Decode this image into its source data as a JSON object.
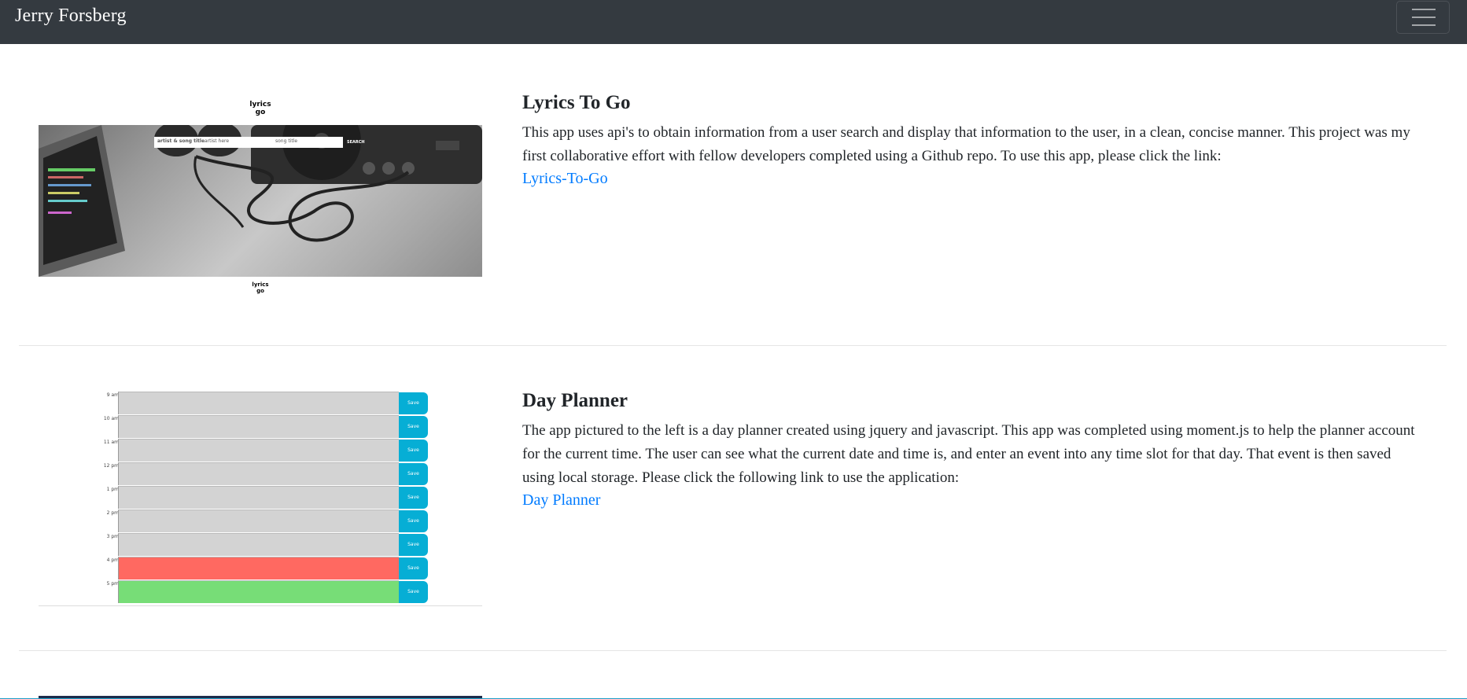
{
  "navbar": {
    "brand": "Jerry Forsberg",
    "menu_icon": "hamburger-menu-icon",
    "background": "#343a40"
  },
  "projects": [
    {
      "title": "Lyrics To Go",
      "description": "This app uses api's to obtain information from a user search and display that information to the user, in a clean, concise manner. This project was my first collaborative effort with fellow developers completed using a Github repo. To use this app, please click the link:",
      "link_text": "Lyrics-To-Go",
      "thumbnail": {
        "logo_top": "lyrics go",
        "logo_bottom": "lyrics go",
        "search_label": "artist & song title",
        "artist_placeholder": "artist here",
        "song_placeholder": "song title",
        "search_button": "SEARCH"
      }
    },
    {
      "title": "Day Planner",
      "description": "The app pictured to the left is a day planner created using jquery and javascript. This app was completed using moment.js to help the planner account for the current time. The user can see what the current date and time is, and enter an event into any time slot for that day. That event is then saved using local storage. Please click the following link to use the application:",
      "link_text": "Day Planner",
      "thumbnail": {
        "rows": [
          {
            "hour": "9 am",
            "state": "past",
            "save": "Save"
          },
          {
            "hour": "10 am",
            "state": "past",
            "save": "Save"
          },
          {
            "hour": "11 am",
            "state": "past",
            "save": "Save"
          },
          {
            "hour": "12 pm",
            "state": "past",
            "save": "Save"
          },
          {
            "hour": "1 pm",
            "state": "past",
            "save": "Save"
          },
          {
            "hour": "2 pm",
            "state": "past",
            "save": "Save"
          },
          {
            "hour": "3 pm",
            "state": "past",
            "save": "Save"
          },
          {
            "hour": "4 pm",
            "state": "present",
            "save": "Save"
          },
          {
            "hour": "5 pm",
            "state": "future",
            "save": "Save"
          }
        ],
        "colors": {
          "past": "#d3d3d3",
          "present": "#ff6961",
          "future": "#77dd77"
        }
      }
    }
  ],
  "colors": {
    "link": "#007bff",
    "save_button": "#06aed5"
  }
}
